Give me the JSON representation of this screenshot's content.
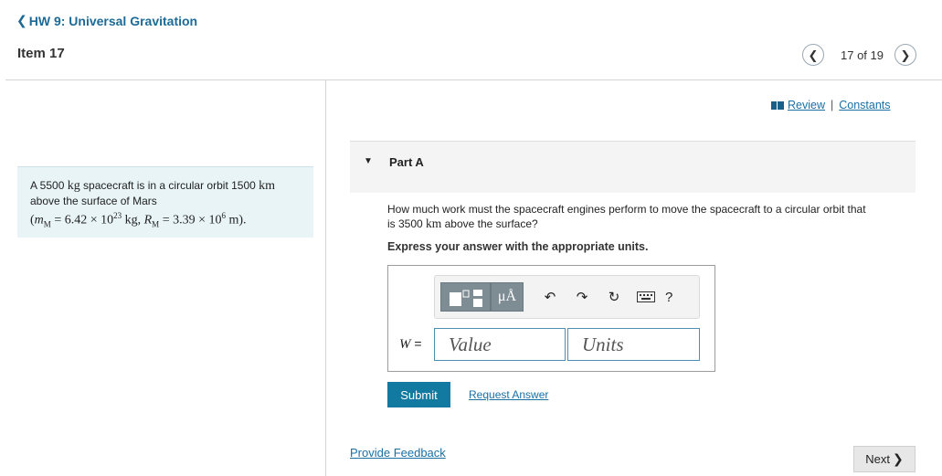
{
  "header": {
    "back_label": "HW 9: Universal Gravitation",
    "item_title": "Item 17",
    "pager_text": "17 of 19"
  },
  "problem": {
    "line1_prefix": "A 5500 ",
    "line1_unit1": "kg",
    "line1_mid": " spacecraft is in a circular orbit 1500 ",
    "line1_unit2": "km",
    "line2": "above the surface of Mars",
    "line3_open": "(",
    "line3_mM": "m",
    "line3_mM_sub": "M",
    "line3_mass_value": " = 6.42 × 10",
    "line3_mass_exp": "23",
    "line3_mass_unit": " kg, ",
    "line3_RM": "R",
    "line3_RM_sub": "M",
    "line3_radius_value": " = 3.39 × 10",
    "line3_radius_exp": "6",
    "line3_radius_unit": " m",
    "line3_close": ")."
  },
  "links": {
    "review": "Review",
    "separator": "|",
    "constants": "Constants"
  },
  "part": {
    "label": "Part A",
    "question_line1": "How much work must the spacecraft engines perform to move the spacecraft to a circular orbit that",
    "question_line2_prefix": "is 3500 ",
    "question_line2_unit": "km",
    "question_line2_suffix": " above the surface?",
    "instruction": "Express your answer with the appropriate units."
  },
  "answer": {
    "variable": "W",
    "equals": "=",
    "value_placeholder": "Value",
    "units_placeholder": "Units",
    "toolbar": {
      "mu_label": "μÅ",
      "help_label": "?"
    }
  },
  "actions": {
    "submit": "Submit",
    "request_answer": "Request Answer",
    "provide_feedback": "Provide Feedback",
    "next": "Next"
  },
  "colors": {
    "brand_blue": "#127aa0",
    "link_blue": "#1a6fa3",
    "problem_bg": "#e8f4f6",
    "toolbar_btn": "#7e8c94"
  }
}
